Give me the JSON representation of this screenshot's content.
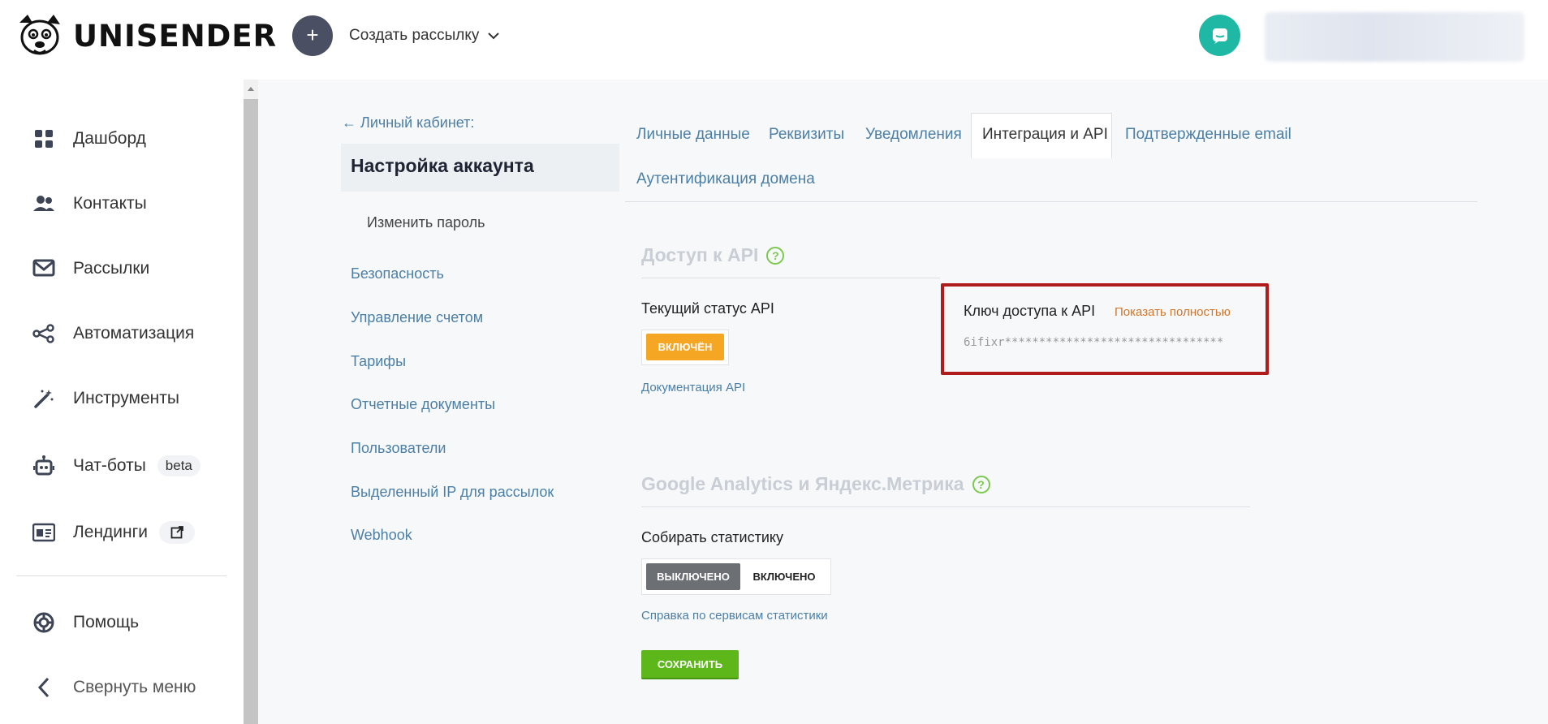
{
  "header": {
    "brand": "UNISENDER",
    "create_label": "Создать рассылку"
  },
  "nav": {
    "items": [
      {
        "label": "Дашборд",
        "icon": "dashboard-icon"
      },
      {
        "label": "Контакты",
        "icon": "contacts-icon"
      },
      {
        "label": "Рассылки",
        "icon": "mail-icon"
      },
      {
        "label": "Автоматизация",
        "icon": "share-icon"
      },
      {
        "label": "Инструменты",
        "icon": "magic-wand-icon"
      },
      {
        "label": "Чат-боты",
        "icon": "robot-icon",
        "badge": "beta"
      },
      {
        "label": "Лендинги",
        "icon": "landing-icon",
        "badge_icon": "external-link-icon"
      },
      {
        "label": "Помощь",
        "icon": "lifebuoy-icon"
      },
      {
        "label": "Свернуть меню",
        "icon": "chevron-left-icon"
      }
    ]
  },
  "sidebar": {
    "back_link": "← Личный кабинет:",
    "title": "Настройка аккаунта",
    "sub_item": "Изменить пароль",
    "links": [
      "Безопасность",
      "Управление счетом",
      "Тарифы",
      "Отчетные документы",
      "Пользователи",
      "Выделенный IP для рассылок",
      "Webhook"
    ]
  },
  "tabs": {
    "items": [
      "Личные данные",
      "Реквизиты",
      "Уведомления",
      "Интеграция и API",
      "Подтвержденные email",
      "Аутентификация домена"
    ],
    "active": "Интеграция и API"
  },
  "api": {
    "section_title": "Доступ к API",
    "status_label": "Текущий статус API",
    "status_value": "ВКЛЮЧЁН",
    "docs_link": "Документация API",
    "key_label": "Ключ доступа к API",
    "show_full": "Показать полностью",
    "key_value": "6ifixr********************************"
  },
  "analytics": {
    "section_title": "Google Analytics и Яндекс.Метрика",
    "collect_label": "Собирать статистику",
    "off_label": "ВЫКЛЮЧЕНО",
    "on_label": "ВКЛЮЧЕНО",
    "help_link": "Справка по сервисам статистики",
    "save_label": "СОХРАНИТЬ"
  },
  "colors": {
    "accent_link": "#4b7fa6",
    "on_orange": "#f5a623",
    "save_green": "#5db61a",
    "highlight_red": "#b01b1b",
    "chat_teal": "#1fb8a5"
  }
}
